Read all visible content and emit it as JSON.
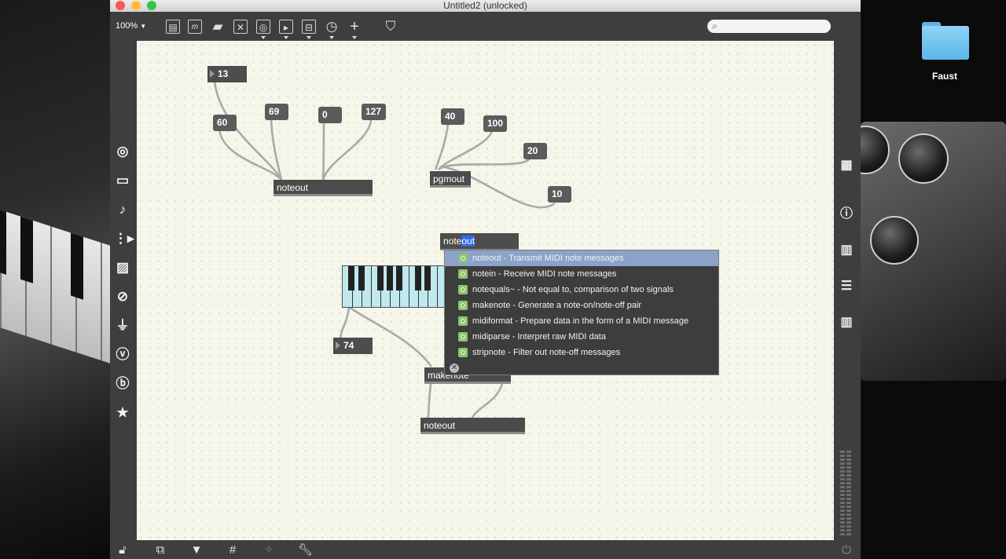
{
  "window": {
    "title": "Untitled2 (unlocked)"
  },
  "toolbar": {
    "zoom": "100%",
    "search_placeholder": ""
  },
  "desktop": {
    "folder_label": "Faust"
  },
  "patch": {
    "numboxes": {
      "n13": "13",
      "n60": "60",
      "n69": "69",
      "n0": "0",
      "n127": "127",
      "n40": "40",
      "n100": "100",
      "n20": "20",
      "n10": "10",
      "n74": "74"
    },
    "objects": {
      "noteout_1": "noteout",
      "pgmout": "pgmout",
      "makenote": "makenote",
      "noteout_2": "noteout"
    },
    "typing": {
      "prefix": "note",
      "selected": "out"
    }
  },
  "autocomplete": {
    "items": [
      {
        "name": "noteout",
        "desc": " - Transmit MIDI note messages"
      },
      {
        "name": "notein",
        "desc": " - Receive MIDI note messages"
      },
      {
        "name": "notequals~",
        "desc": " - Not equal to, comparison of two signals"
      },
      {
        "name": "makenote",
        "desc": " - Generate a note-on/note-off pair"
      },
      {
        "name": "midiformat",
        "desc": " - Prepare data in the form of a MIDI message"
      },
      {
        "name": "midiparse",
        "desc": " - Interpret raw MIDI data"
      },
      {
        "name": "stripnote",
        "desc": " - Filter out note-off messages"
      }
    ],
    "selected_index": 0
  },
  "colors": {
    "canvas": "#f6f5ea",
    "patchcord": "#a9a9a9",
    "highlight": "#8ba3c9",
    "keyboard": "#bfe9ef",
    "object": "#4b4b4b"
  }
}
